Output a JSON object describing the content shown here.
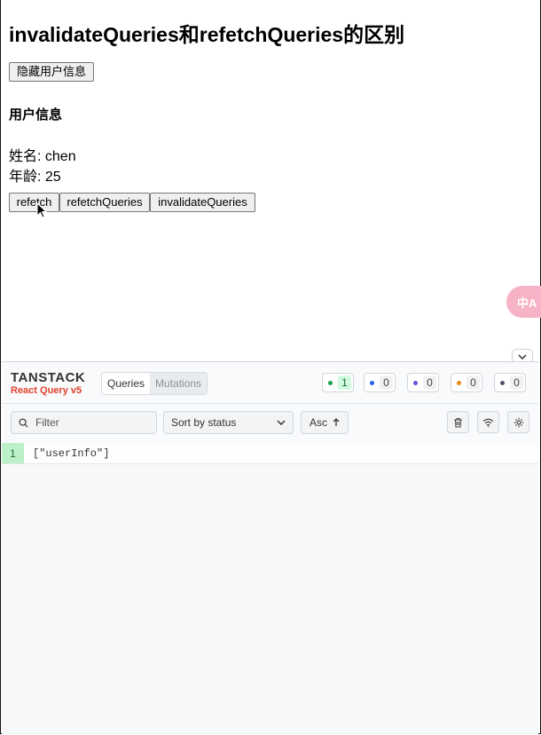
{
  "page": {
    "title": "invalidateQueries和refetchQueries的区别",
    "hide_button": "隐藏用户信息",
    "section_title": "用户信息",
    "name_line": "姓名: chen",
    "age_line": "年龄: 25",
    "buttons": [
      "refetch",
      "refetchQueries",
      "invalidateQueries"
    ],
    "translate_badge": "中A"
  },
  "devtools": {
    "logo_top": "TANSTACK",
    "logo_bottom": "React Query v5",
    "tabs": [
      "Queries",
      "Mutations"
    ],
    "status_counts": [
      {
        "color": "#16a34a",
        "count": "1",
        "highlight": "#d1fadf"
      },
      {
        "color": "#2563eb",
        "count": "0"
      },
      {
        "color": "#6b4fd8",
        "count": "0"
      },
      {
        "color": "#ea8c1a",
        "count": "0"
      },
      {
        "color": "#4b5563",
        "count": "0"
      }
    ],
    "filter_placeholder": "Filter",
    "sort_label": "Sort by status",
    "order_label": "Asc",
    "queries": [
      {
        "observers": "1",
        "key": "[\"userInfo\"]"
      }
    ],
    "icons": [
      "search-icon",
      "chevron-down-icon",
      "arrow-up-icon",
      "trash-icon",
      "wifi-icon",
      "gear-icon",
      "chevron-down-icon"
    ]
  }
}
